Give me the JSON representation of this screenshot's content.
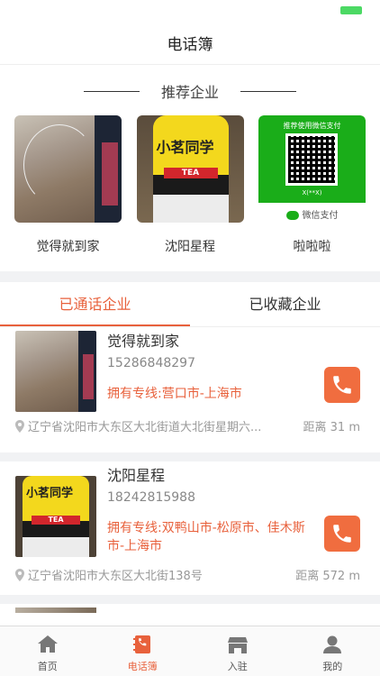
{
  "header": {
    "title": "电话簿"
  },
  "recommend": {
    "heading": "推荐企业",
    "items": [
      {
        "name": "觉得就到家",
        "image": "desk-photo"
      },
      {
        "name": "沈阳星程",
        "image": "tea-bottle-photo",
        "image_text": "小茗同学",
        "image_badge": "TEA"
      },
      {
        "name": "啦啦啦",
        "image": "wechat-pay-qr",
        "qr_title": "推荐使用微信支付",
        "qr_sub": "X(**X)",
        "pay_label": "微信支付"
      }
    ]
  },
  "tabs": {
    "called": "已通话企业",
    "favorited": "已收藏企业",
    "active": "called"
  },
  "companies": [
    {
      "name": "觉得就到家",
      "phone": "15286848297",
      "lines": "拥有专线:营口市-上海市",
      "address": "辽宁省沈阳市大东区大北街道大北街星期六...",
      "distance": "距离 31 m",
      "image": "desk-photo"
    },
    {
      "name": "沈阳星程",
      "phone": "18242815988",
      "lines": "拥有专线:双鸭山市-松原市、佳木斯市-上海市",
      "address": "辽宁省沈阳市大东区大北街138号",
      "distance": "距离 572 m",
      "image": "tea-bottle-photo",
      "image_text": "小茗同学",
      "image_badge": "TEA"
    }
  ],
  "tabbar": {
    "items": [
      {
        "label": "首页",
        "icon": "home-icon"
      },
      {
        "label": "电话簿",
        "icon": "phonebook-icon",
        "active": true
      },
      {
        "label": "入驻",
        "icon": "store-icon"
      },
      {
        "label": "我的",
        "icon": "user-icon"
      }
    ]
  },
  "colors": {
    "accent": "#e8613c",
    "call_button": "#f06d3f",
    "battery": "#4cd964",
    "wechat_green": "#1aad19"
  }
}
